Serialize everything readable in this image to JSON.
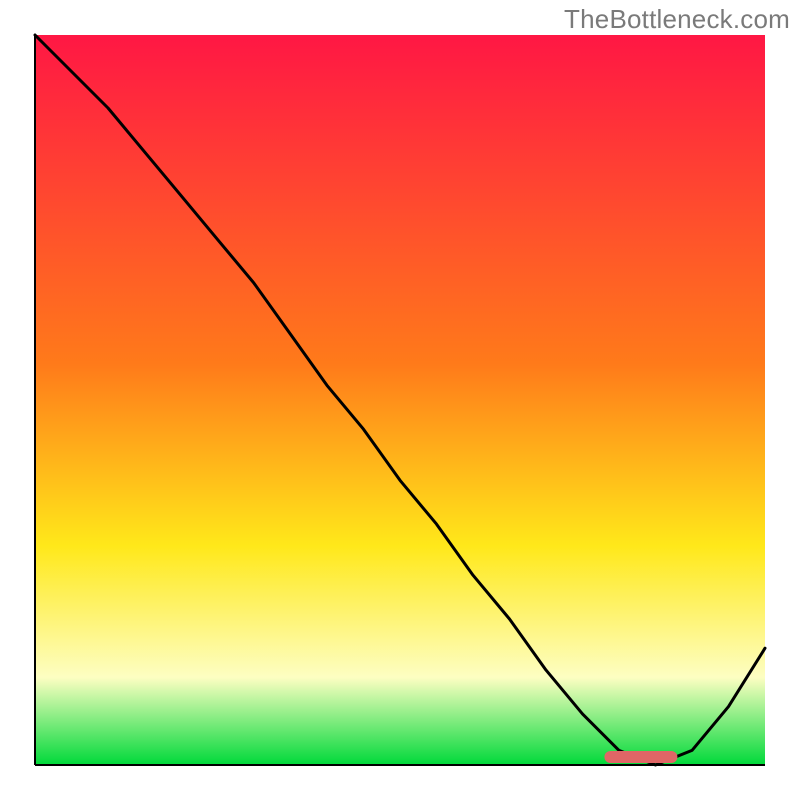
{
  "watermark": {
    "text": "TheBottleneck.com"
  },
  "chart_data": {
    "type": "line",
    "title": "",
    "xlabel": "",
    "ylabel": "",
    "xlim": [
      0,
      100
    ],
    "ylim": [
      0,
      100
    ],
    "x": [
      0,
      5,
      10,
      15,
      20,
      25,
      30,
      35,
      40,
      45,
      50,
      55,
      60,
      65,
      70,
      75,
      80,
      85,
      90,
      95,
      100
    ],
    "values": [
      100,
      95,
      90,
      84,
      78,
      72,
      66,
      59,
      52,
      46,
      39,
      33,
      26,
      20,
      13,
      7,
      2,
      0,
      2,
      8,
      16
    ],
    "optimum_range_x": [
      78,
      88
    ],
    "gradient_stops": [
      {
        "offset": 0.0,
        "color": "#ff1744"
      },
      {
        "offset": 0.45,
        "color": "#ff7a1a"
      },
      {
        "offset": 0.7,
        "color": "#ffe81a"
      },
      {
        "offset": 0.88,
        "color": "#fdfec2"
      },
      {
        "offset": 1.0,
        "color": "#00d93a"
      }
    ]
  }
}
